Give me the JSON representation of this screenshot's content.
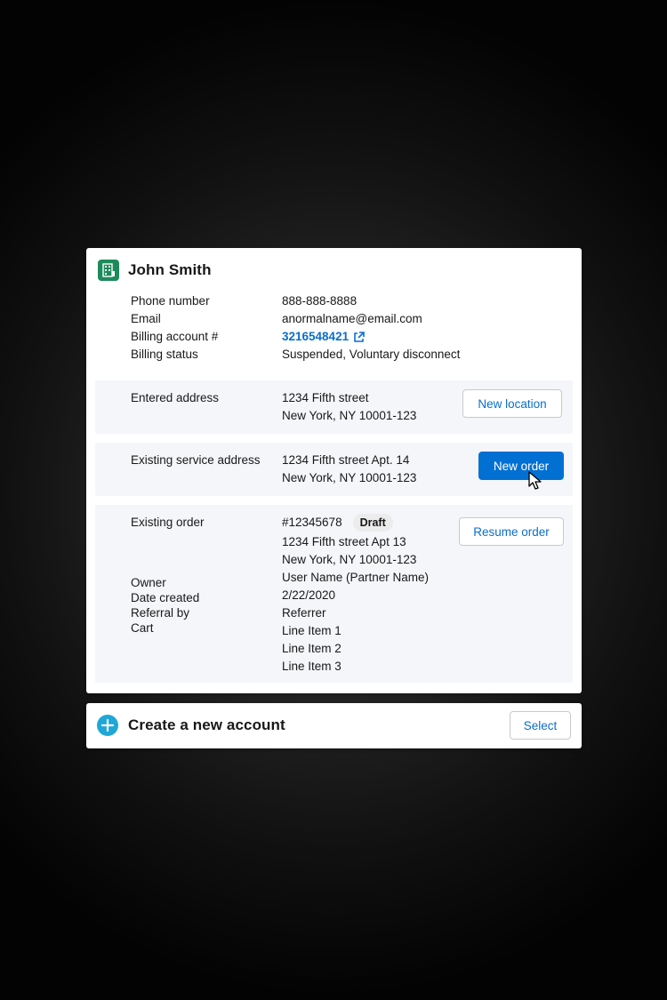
{
  "account": {
    "name": "John Smith",
    "icon": "building-icon",
    "fields": [
      {
        "label": "Phone number",
        "value": "888-888-8888"
      },
      {
        "label": "Email",
        "value": "anormalname@email.com"
      },
      {
        "label": "Billing account #",
        "value": "3216548421"
      },
      {
        "label": "Billing status",
        "value": "Suspended, Voluntary disconnect"
      }
    ]
  },
  "entered_address": {
    "label": "Entered address",
    "lines": [
      "1234 Fifth street",
      "New York, NY 10001-123"
    ],
    "button": "New location"
  },
  "service_address": {
    "label": "Existing service address",
    "lines": [
      "1234 Fifth street Apt. 14",
      "New York, NY 10001-123"
    ],
    "button": "New order"
  },
  "existing_order": {
    "label": "Existing order",
    "order_number": "#12345678",
    "badge": "Draft",
    "lines": [
      "1234 Fifth street Apt 13",
      "New York, NY 10001-123",
      "User Name (Partner Name)",
      "2/22/2020",
      "Referrer",
      "Line Item 1",
      "Line Item 2",
      "Line Item 3"
    ],
    "sub_labels": [
      "Owner",
      "Date created",
      "Referral by",
      "Cart"
    ],
    "button": "Resume order"
  },
  "create_account": {
    "title": "Create a new account",
    "icon": "plus-icon",
    "button": "Select"
  },
  "colors": {
    "link": "#0b6ec9",
    "primary_button": "#0270d3",
    "account_icon": "#1e8a5a",
    "plus_icon": "#1fa7d6",
    "section_bg": "#f4f6f9"
  }
}
